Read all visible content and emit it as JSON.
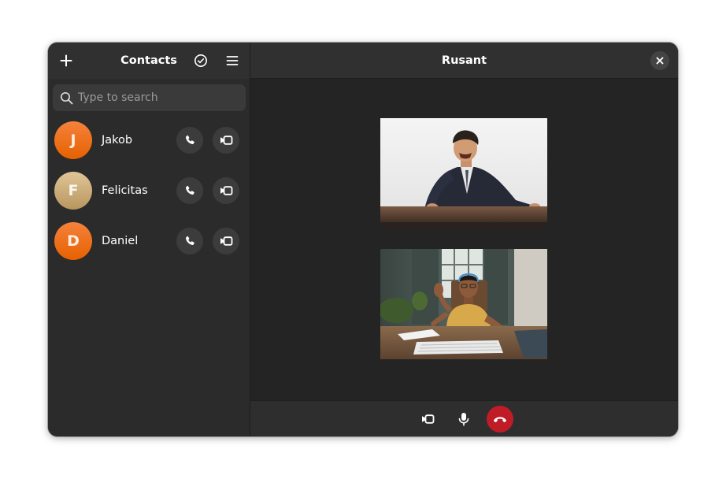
{
  "sidebar": {
    "title": "Contacts",
    "search": {
      "placeholder": "Type to search",
      "value": ""
    },
    "contacts": [
      {
        "initial": "J",
        "name": "Jakob",
        "color_start": "#f5823c",
        "color_end": "#e66100"
      },
      {
        "initial": "F",
        "name": "Felicitas",
        "color_start": "#e0c596",
        "color_end": "#b8965f"
      },
      {
        "initial": "D",
        "name": "Daniel",
        "color_start": "#f5823c",
        "color_end": "#e66100"
      }
    ],
    "icons": {
      "add": "plus-icon",
      "select": "check-circle-icon",
      "menu": "hamburger-menu-icon"
    }
  },
  "call": {
    "title": "Rusant",
    "participants": [
      {
        "name": "remote-video",
        "depicts": "man-in-suit-at-desk"
      },
      {
        "name": "local-video",
        "depicts": "woman-waving-at-desk"
      }
    ],
    "controls": {
      "camera": "camera-icon",
      "microphone": "microphone-icon",
      "hangup": "hangup-icon"
    },
    "hangup_color": "#c01c28"
  },
  "colors": {
    "window_bg": "#242424",
    "sidebar_bg": "#2b2b2b",
    "header_bg": "#303030",
    "button_bg": "#3c3c3c"
  }
}
